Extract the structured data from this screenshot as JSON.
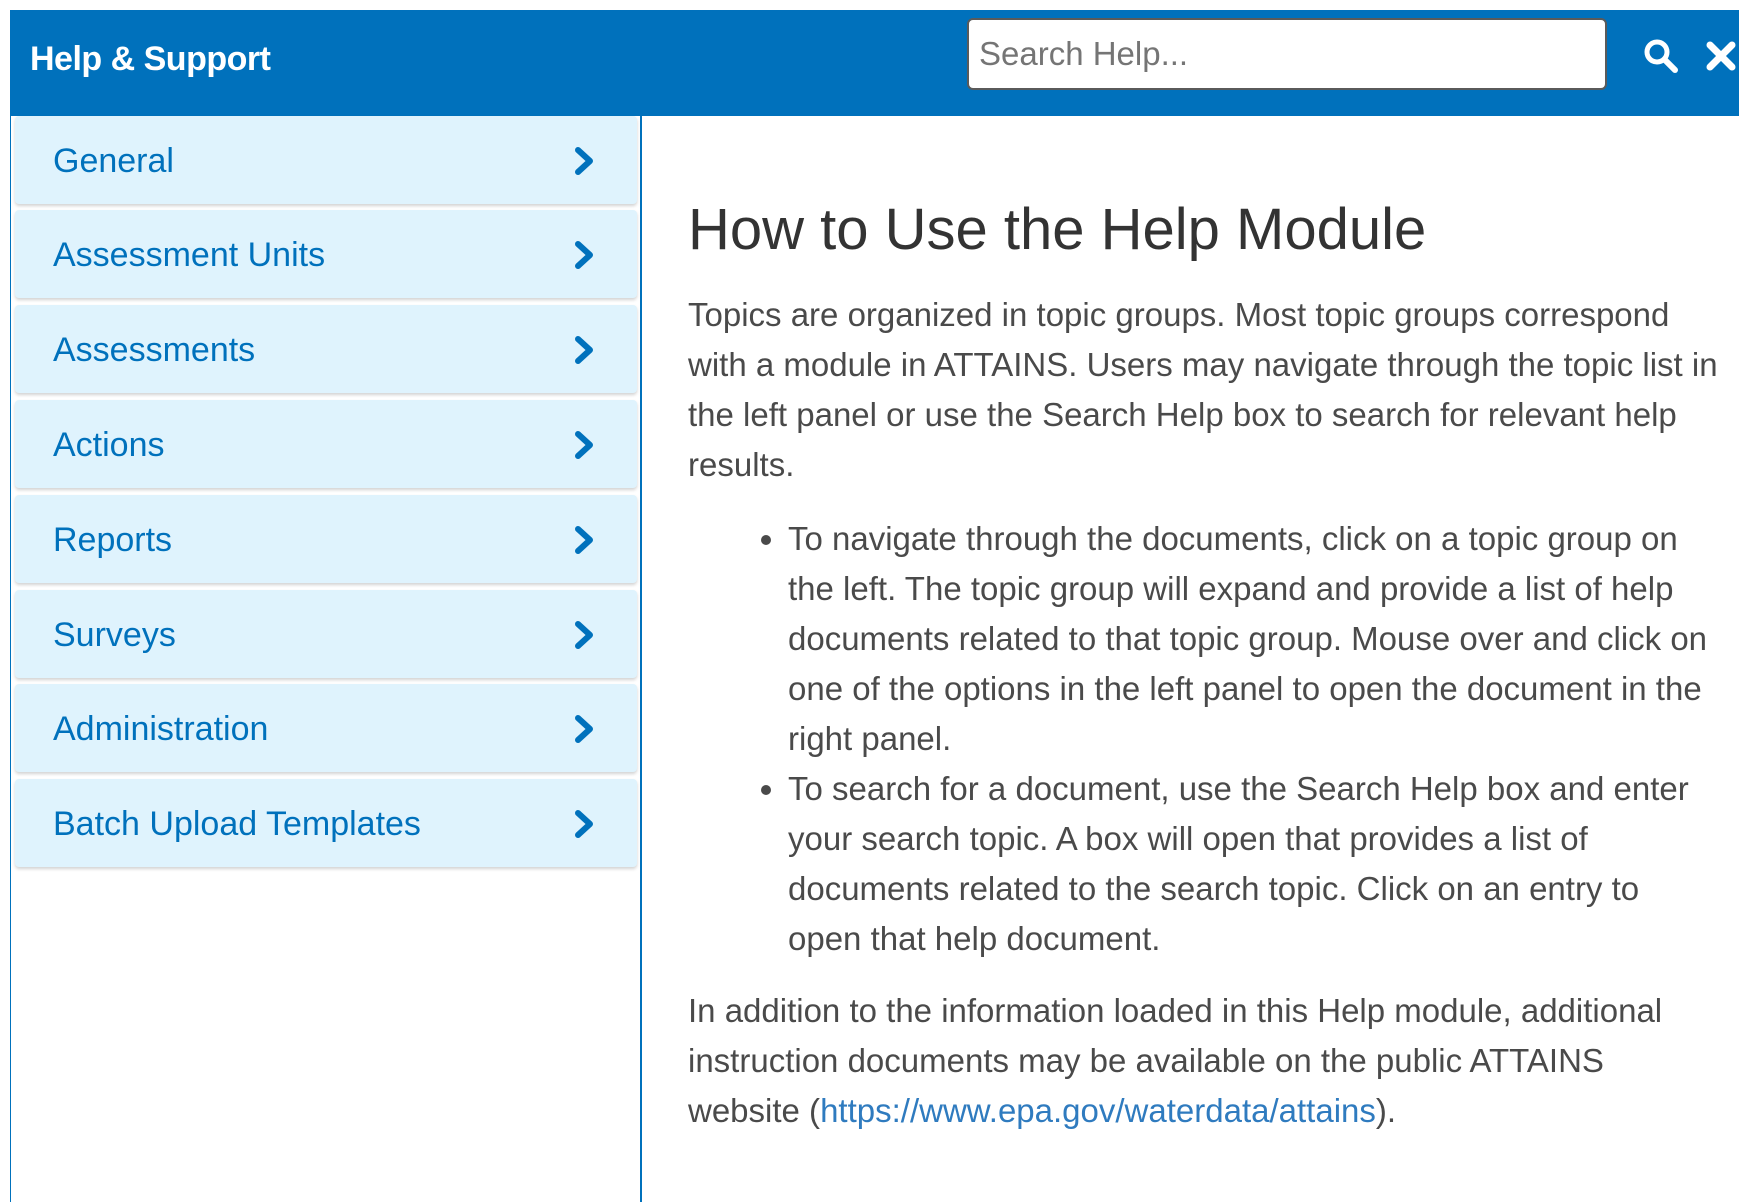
{
  "header": {
    "title": "Help & Support",
    "search_placeholder": "Search Help...",
    "search_value": "",
    "search_icon": "search-icon",
    "close_icon": "close-icon",
    "background_color": "#0071bc"
  },
  "sidebar": {
    "items": [
      {
        "label": "General",
        "icon": "chevron-right-icon"
      },
      {
        "label": "Assessment Units",
        "icon": "chevron-right-icon"
      },
      {
        "label": "Assessments",
        "icon": "chevron-right-icon"
      },
      {
        "label": "Actions",
        "icon": "chevron-right-icon"
      },
      {
        "label": "Reports",
        "icon": "chevron-right-icon"
      },
      {
        "label": "Surveys",
        "icon": "chevron-right-icon"
      },
      {
        "label": "Administration",
        "icon": "chevron-right-icon"
      },
      {
        "label": "Batch Upload Templates",
        "icon": "chevron-right-icon"
      }
    ],
    "item_background": "#dff3fd",
    "item_text_color": "#0071bc"
  },
  "main": {
    "title": "How to Use the Help Module",
    "intro": "Topics are organized in topic groups. Most topic groups correspond with a module in ATTAINS. Users may navigate through the topic list in the left panel or use the Search Help box to search for relevant help results.",
    "bullets": [
      "To navigate through the documents, click on a topic group on the left. The topic group will expand and provide a list of help documents related to that topic group. Mouse over and click on one of the options in the left panel to open the document in the right panel.",
      "To search for a document, use the Search Help box and enter your search topic. A box will open that provides a list of documents related to the search topic. Click on an entry to open that help document."
    ],
    "outro_before_link": "In addition to the information loaded in this Help module, additional instruction documents may be available on the public ATTAINS website (",
    "outro_link": "https://www.epa.gov/waterdata/attains",
    "outro_after_link": ")."
  }
}
